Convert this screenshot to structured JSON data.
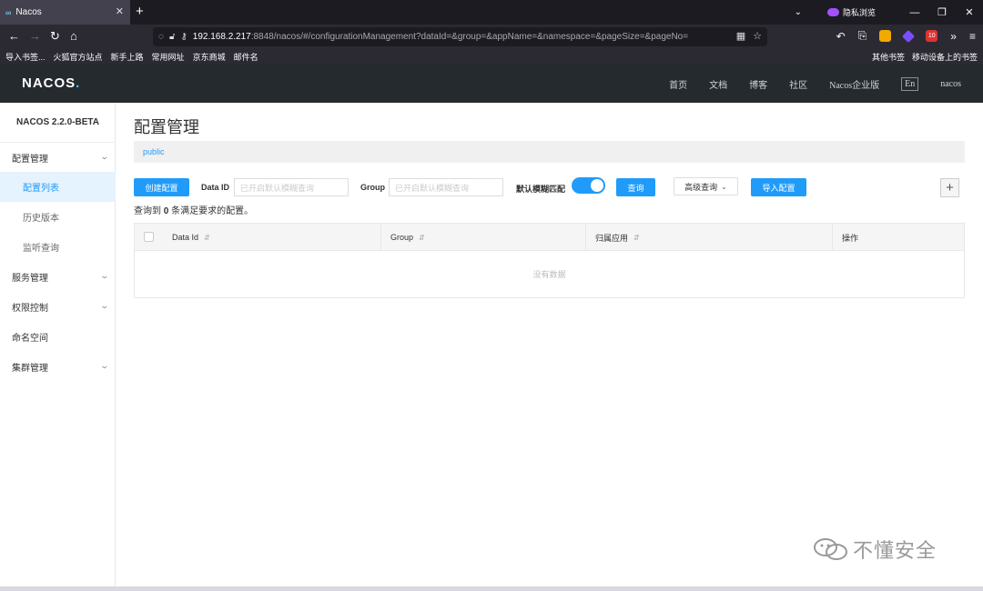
{
  "browser": {
    "tab_title": "Nacos",
    "tab_icon": "∞",
    "private_label": "隐私浏览",
    "url_host": "192.168.2.217",
    "url_rest": ":8848/nacos/#/configurationManagement?dataId=&group=&appName=&namespace=&pageSize=&pageNo=",
    "badge_count": "10",
    "bookmarks": [
      "导入书签...",
      "火狐官方站点",
      "新手上路",
      "常用网址",
      "京东商城",
      "邮件名"
    ],
    "bookmarks_right": [
      "其他书签",
      "移动设备上的书签"
    ]
  },
  "header": {
    "logo": "NACOS",
    "nav": [
      "首页",
      "文档",
      "博客",
      "社区",
      "Nacos企业版"
    ],
    "lang": "En",
    "user": "nacos"
  },
  "sidebar": {
    "title": "NACOS 2.2.0-BETA",
    "items": [
      {
        "label": "配置管理",
        "expandable": true
      },
      {
        "label": "配置列表",
        "active": true
      },
      {
        "label": "历史版本"
      },
      {
        "label": "监听查询"
      },
      {
        "label": "服务管理",
        "expandable": true
      },
      {
        "label": "权限控制",
        "expandable": true
      },
      {
        "label": "命名空间"
      },
      {
        "label": "集群管理",
        "expandable": true
      }
    ]
  },
  "main": {
    "title": "配置管理",
    "namespace": "public",
    "create_button": "创建配置",
    "data_id_label": "Data ID",
    "data_id_placeholder": "已开启默认模糊查询",
    "group_label": "Group",
    "group_placeholder": "已开启默认模糊查询",
    "fuzzy_label": "默认模糊匹配",
    "fuzzy_enabled": true,
    "query_button": "查询",
    "advanced_button": "高级查询",
    "import_button": "导入配置",
    "plus_button": "+",
    "result_prefix": "查询到",
    "result_count": "0",
    "result_suffix": "条满足要求的配置。",
    "columns": [
      "Data Id",
      "Group",
      "归属应用",
      "操作"
    ],
    "empty_text": "没有数据"
  },
  "watermark": "不懂安全",
  "colors": {
    "accent": "#209bfa",
    "header_bg": "#252a2f",
    "browser_bg": "#2b2a33"
  }
}
